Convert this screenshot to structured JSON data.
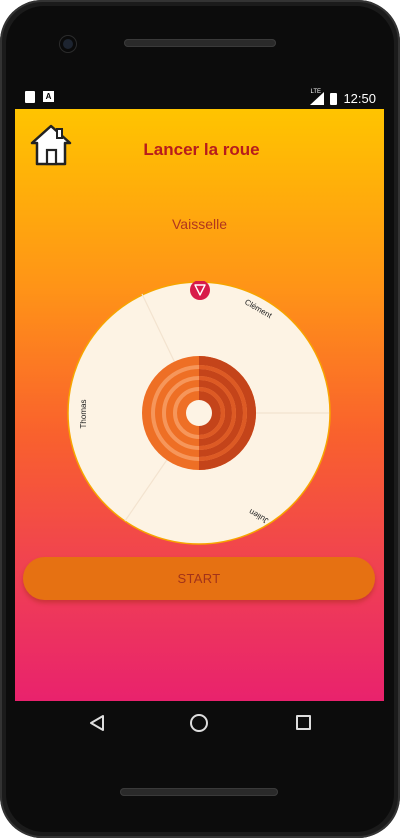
{
  "status_bar": {
    "left_icons": [
      "sd-card-icon",
      "a-notification-icon"
    ],
    "a_icon_letter": "A",
    "network_label": "LTE",
    "time": "12:50"
  },
  "header": {
    "title": "Lancer la roue",
    "home_icon": "home-icon"
  },
  "task": {
    "name": "Vaisselle"
  },
  "wheel": {
    "segments": [
      {
        "label": "Clément"
      },
      {
        "label": "Julien"
      },
      {
        "label": "Thomas"
      }
    ],
    "pointer_icon": "triangle-pointer-icon",
    "colors": {
      "face": "#fdf3e4",
      "rim": "#f7a400",
      "pointer": "#d81b49",
      "hub_light": "#ee6f25",
      "hub_dark": "#c4441a"
    }
  },
  "actions": {
    "start_label": "START"
  },
  "nav_bar": {
    "icons": [
      "back-icon",
      "home-circle-icon",
      "recents-icon"
    ]
  },
  "colors": {
    "gradient_top": "#ffc400",
    "gradient_bottom": "#e9226d",
    "title_color": "#b71c1c",
    "button_color": "#e67112"
  }
}
